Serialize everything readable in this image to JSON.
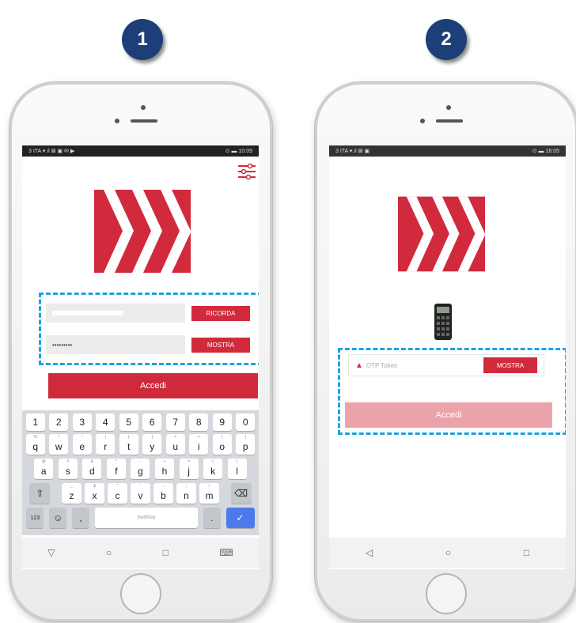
{
  "steps": [
    {
      "label": "1"
    },
    {
      "label": "2"
    }
  ],
  "screen1": {
    "status_left": "3 ITA ▾.ıl ⊠ ▣ ✉ ▶",
    "status_right": "⊙ ▬ 10:09",
    "username_value": "",
    "remember_button": "RICORDA",
    "password_value": "•••••••••",
    "show_button": "MOSTRA",
    "login_button": "Accedi",
    "keyboard": {
      "row_numbers": [
        "1",
        "2",
        "3",
        "4",
        "5",
        "6",
        "7",
        "8",
        "9",
        "0"
      ],
      "row_top": [
        [
          "q",
          "%"
        ],
        [
          "w",
          "^"
        ],
        [
          "e",
          "~"
        ],
        [
          "r",
          "|"
        ],
        [
          "t",
          "["
        ],
        [
          "y",
          "]"
        ],
        [
          "u",
          "<"
        ],
        [
          "i",
          ">"
        ],
        [
          "o",
          "{"
        ],
        [
          "p",
          "}"
        ]
      ],
      "row_mid": [
        [
          "a",
          "@"
        ],
        [
          "s",
          "#"
        ],
        [
          "d",
          "&"
        ],
        [
          "f",
          "*"
        ],
        [
          "g",
          "-"
        ],
        [
          "h",
          "+"
        ],
        [
          "j",
          "="
        ],
        [
          "k",
          "("
        ],
        [
          "l",
          ")"
        ]
      ],
      "row_bottom": [
        [
          "z",
          "_"
        ],
        [
          "x",
          "$"
        ],
        [
          "c",
          "\""
        ],
        [
          "v",
          "'"
        ],
        [
          "b",
          ":"
        ],
        [
          "n",
          ";"
        ],
        [
          "m",
          "/"
        ]
      ],
      "key_123": "123",
      "space_label": "SwiftKey",
      "comma": ",",
      "period": "."
    }
  },
  "screen2": {
    "status_left": "3 ITA ▾.ıl ⊠ ▣",
    "status_right": "⊙ ▬ 16:05",
    "otp_placeholder": "OTP Token",
    "show_button": "MOSTRA",
    "login_button": "Accedi"
  },
  "colors": {
    "brand_red": "#d12a3c",
    "dashed_highlight": "#1aa3e0",
    "step_badge": "#1c3f7a"
  }
}
